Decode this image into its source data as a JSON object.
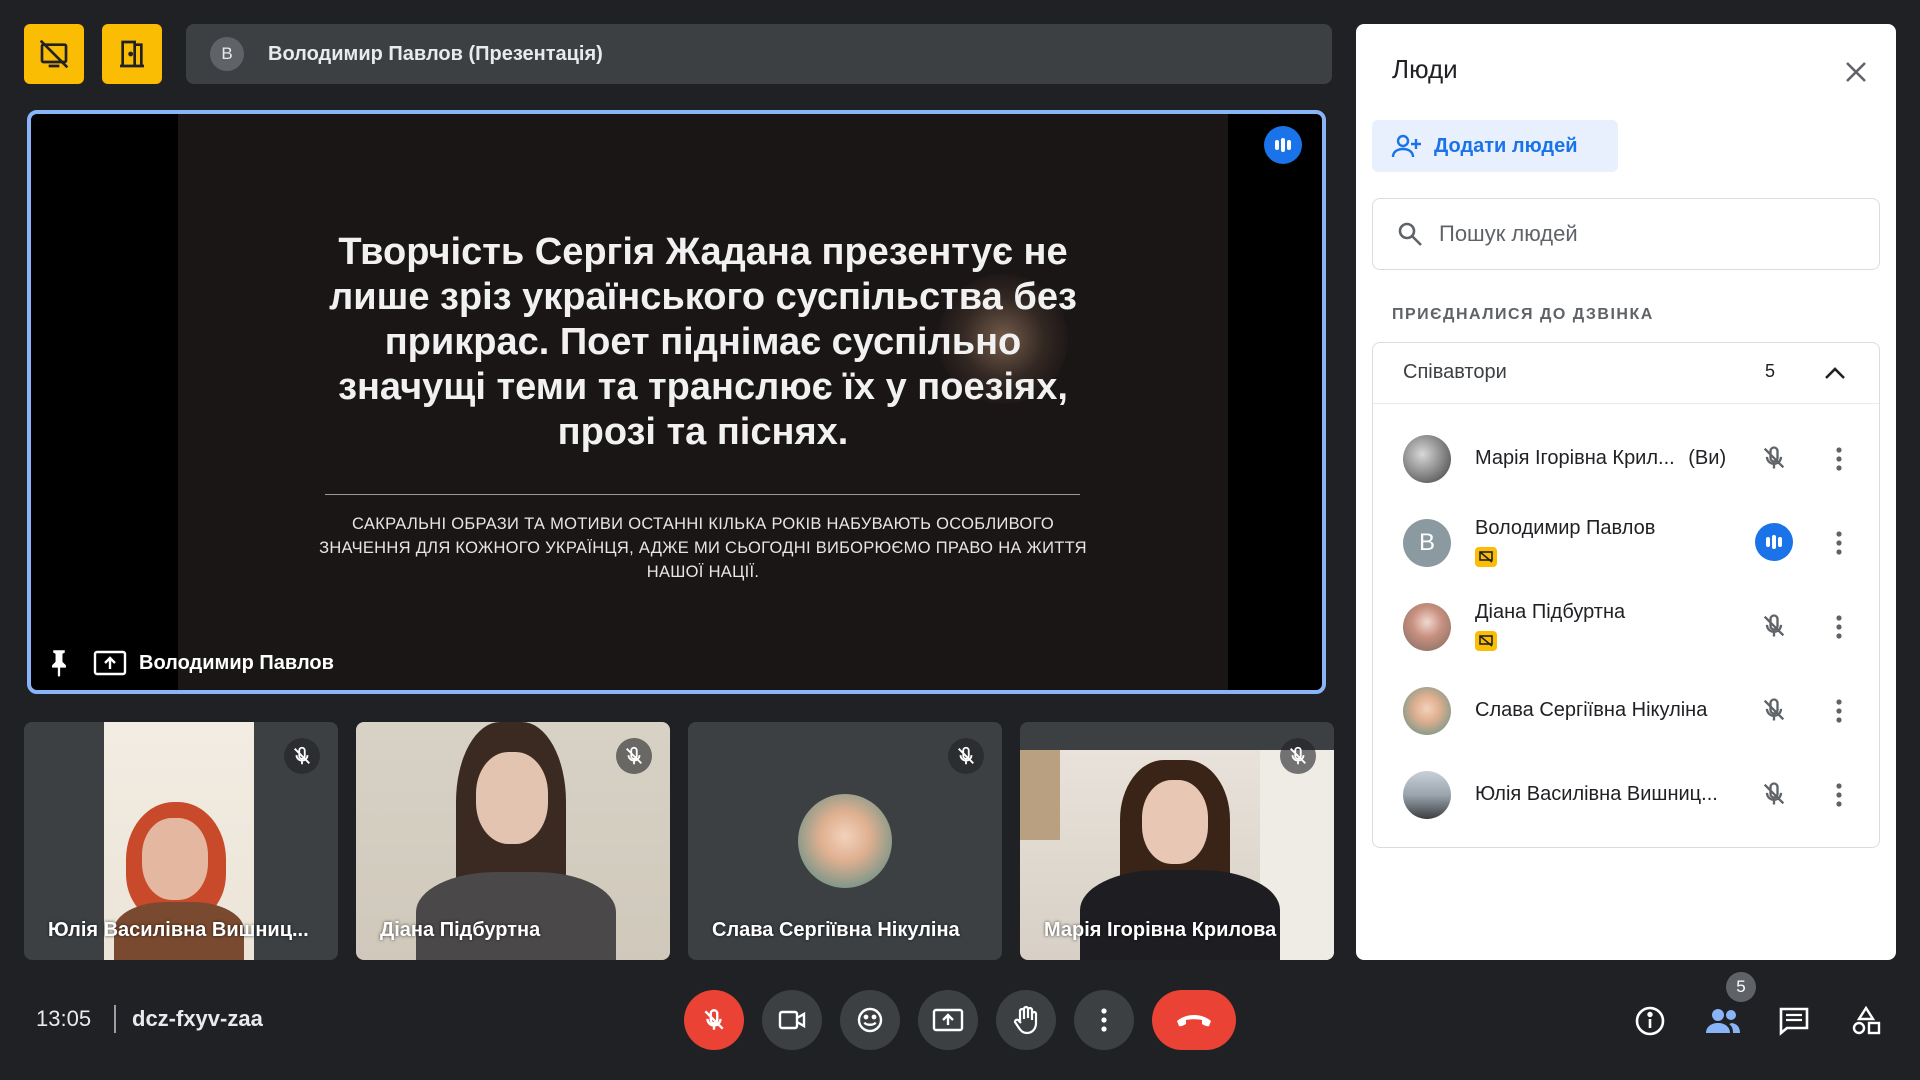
{
  "top": {
    "presenter_initial": "В",
    "presenter_title": "Володимир Павлов (Презентація)"
  },
  "main": {
    "slide_heading": "Творчість Сергія Жадана презентує не лише зріз українського суспільства без прикрас. Поет піднімає суспільно значущі теми та транслює їх у поезіях, прозі та піснях.",
    "slide_subtext": "САКРАЛЬНІ ОБРАЗИ ТА МОТИВИ ОСТАННІ КІЛЬКА РОКІВ НАБУВАЮТЬ ОСОБЛИВОГО ЗНАЧЕННЯ ДЛЯ КОЖНОГО УКРАЇНЦЯ, АДЖЕ МИ СЬОГОДНІ ВИБОРЮЄМО ПРАВО НА ЖИТТЯ НАШОЇ НАЦІЇ.",
    "presenter_name": "Володимир Павлов"
  },
  "thumbnails": [
    {
      "name": "Юлія Василівна Вишниц..."
    },
    {
      "name": "Діана Підбуртна"
    },
    {
      "name": "Слава Сергіївна Нікуліна"
    },
    {
      "name": "Марія Ігорівна Крилова"
    }
  ],
  "panel": {
    "title": "Люди",
    "add_people": "Додати людей",
    "search_placeholder": "Пошук людей",
    "section_label": "ПРИЄДНАЛИСЯ ДО ДЗВІНКА",
    "group_name": "Співавтори",
    "group_count": "5",
    "people": [
      {
        "name": "Марія Ігорівна Крил...",
        "suffix": "(Ви)"
      },
      {
        "name": "Володимир Павлов",
        "initial": "В"
      },
      {
        "name": "Діана Підбуртна"
      },
      {
        "name": "Слава Сергіївна Нікуліна"
      },
      {
        "name": "Юлія Василівна Вишниц..."
      }
    ]
  },
  "bottom": {
    "time": "13:05",
    "meeting_code": "dcz-fxyv-zaa",
    "people_count": "5"
  },
  "colors": {
    "background": "#202124",
    "accent_blue": "#1a73e8",
    "warning_yellow": "#fbbc04",
    "danger_red": "#ea4335"
  }
}
